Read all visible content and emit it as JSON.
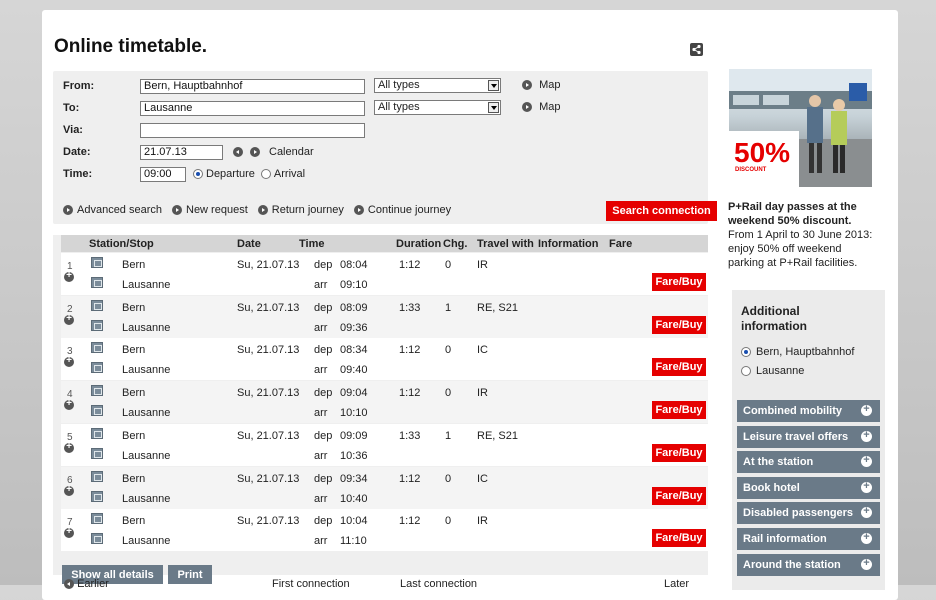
{
  "page": {
    "title": "Online timetable."
  },
  "form": {
    "from_label": "From:",
    "from_value": "Bern, Hauptbahnhof",
    "to_label": "To:",
    "to_value": "Lausanne",
    "via_label": "Via:",
    "via_value": "",
    "date_label": "Date:",
    "date_value": "21.07.13",
    "time_label": "Time:",
    "time_value": "09:00",
    "type_from": "All types",
    "type_to": "All types",
    "map_label": "Map",
    "calendar_label": "Calendar",
    "departure_label": "Departure",
    "arrival_label": "Arrival",
    "advanced_search": "Advanced search",
    "new_request": "New request",
    "return_journey": "Return journey",
    "continue_journey": "Continue journey",
    "search_button": "Search connection"
  },
  "results": {
    "headers": {
      "station": "Station/Stop",
      "date": "Date",
      "time": "Time",
      "duration": "Duration",
      "changes": "Chg.",
      "travel_with": "Travel with",
      "information": "Information",
      "fare": "Fare"
    },
    "fare_button": "Fare/Buy",
    "dep_prefix": "dep",
    "arr_prefix": "arr",
    "rows": [
      {
        "num": "1",
        "from": "Bern",
        "to": "Lausanne",
        "date": "Su, 21.07.13",
        "dep": "08:04",
        "arr": "09:10",
        "duration": "1:12",
        "changes": "0",
        "travel": "IR"
      },
      {
        "num": "2",
        "from": "Bern",
        "to": "Lausanne",
        "date": "Su, 21.07.13",
        "dep": "08:09",
        "arr": "09:36",
        "duration": "1:33",
        "changes": "1",
        "travel": "RE, S21"
      },
      {
        "num": "3",
        "from": "Bern",
        "to": "Lausanne",
        "date": "Su, 21.07.13",
        "dep": "08:34",
        "arr": "09:40",
        "duration": "1:12",
        "changes": "0",
        "travel": "IC"
      },
      {
        "num": "4",
        "from": "Bern",
        "to": "Lausanne",
        "date": "Su, 21.07.13",
        "dep": "09:04",
        "arr": "10:10",
        "duration": "1:12",
        "changes": "0",
        "travel": "IR"
      },
      {
        "num": "5",
        "from": "Bern",
        "to": "Lausanne",
        "date": "Su, 21.07.13",
        "dep": "09:09",
        "arr": "10:36",
        "duration": "1:33",
        "changes": "1",
        "travel": "RE, S21"
      },
      {
        "num": "6",
        "from": "Bern",
        "to": "Lausanne",
        "date": "Su, 21.07.13",
        "dep": "09:34",
        "arr": "10:40",
        "duration": "1:12",
        "changes": "0",
        "travel": "IC"
      },
      {
        "num": "7",
        "from": "Bern",
        "to": "Lausanne",
        "date": "Su, 21.07.13",
        "dep": "10:04",
        "arr": "11:10",
        "duration": "1:12",
        "changes": "0",
        "travel": "IR"
      }
    ],
    "show_all_details": "Show all details",
    "print": "Print",
    "earlier": "Earlier",
    "first_connection": "First connection",
    "last_connection": "Last connection",
    "later": "Later"
  },
  "promo": {
    "discount": "50%",
    "discount_sub": "DISCOUNT",
    "heading": "P+Rail day passes at the weekend 50% discount.",
    "body": "From 1 April to 30 June 2013: enjoy 50% off weekend parking at P+Rail facilities."
  },
  "sidebar": {
    "title": "Additional information",
    "stations": [
      "Bern, Hauptbahnhof",
      "Lausanne"
    ],
    "items": [
      "Combined mobility",
      "Leisure travel offers",
      "At the station",
      "Book hotel",
      "Disabled passengers",
      "Rail information",
      "Around the station"
    ]
  },
  "colors": {
    "accent_red": "#e50000",
    "button_gray": "#6a7a88"
  }
}
